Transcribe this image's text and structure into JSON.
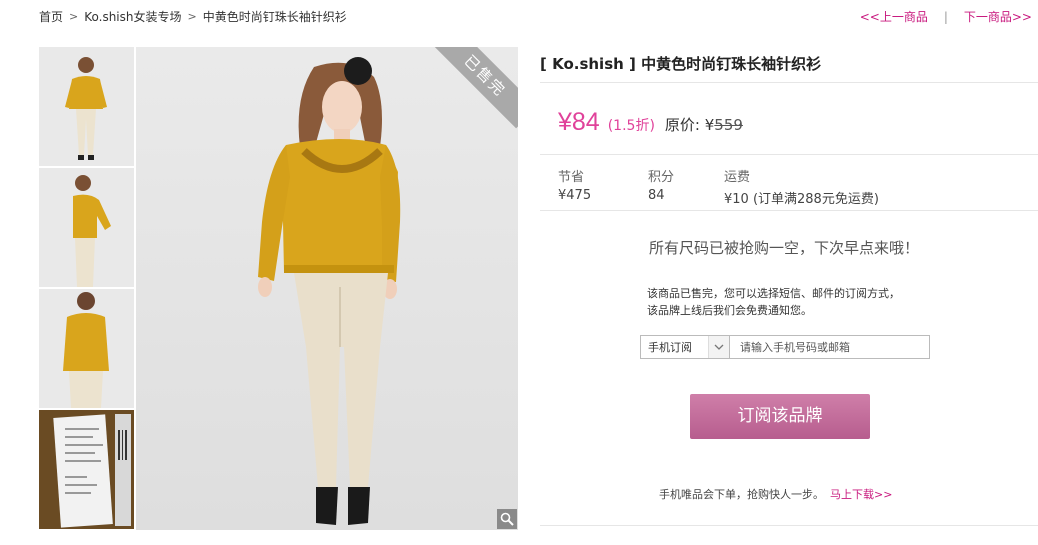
{
  "breadcrumb": {
    "home": "首页",
    "store": "Ko.shish女装专场",
    "current": "中黄色时尚钉珠长袖针织衫"
  },
  "pager": {
    "prev": "<<上一商品",
    "divider": "|",
    "next": "下一商品>>"
  },
  "product": {
    "title": "[ Ko.shish ] 中黄色时尚钉珠长袖针织衫",
    "price": "¥84",
    "discount": "(1.5折)",
    "orig_label": "原价: ¥",
    "orig_price": "559",
    "sold_badge": "已售完"
  },
  "stats": [
    {
      "label": "节省",
      "value": "¥475"
    },
    {
      "label": "积分",
      "value": "84"
    },
    {
      "label": "运费",
      "value": "¥10 (订单满288元免运费)"
    }
  ],
  "soldout": {
    "message": "所有尺码已被抢购一空，下次早点来哦！",
    "notice_line1": "该商品已售完，您可以选择短信、邮件的订阅方式，",
    "notice_line2": "该品牌上线后我们会免费通知您。"
  },
  "subscribe": {
    "method": "手机订阅",
    "placeholder": "请输入手机号码或邮箱",
    "button": "订阅该品牌"
  },
  "mobile": {
    "text": "手机唯品会下单，抢购快人一步。",
    "link": "马上下载>>"
  },
  "colors": {
    "accent": "#e0429a",
    "link": "#c8197e",
    "button": "#c06f9b",
    "sweater": "#d9a51c"
  }
}
